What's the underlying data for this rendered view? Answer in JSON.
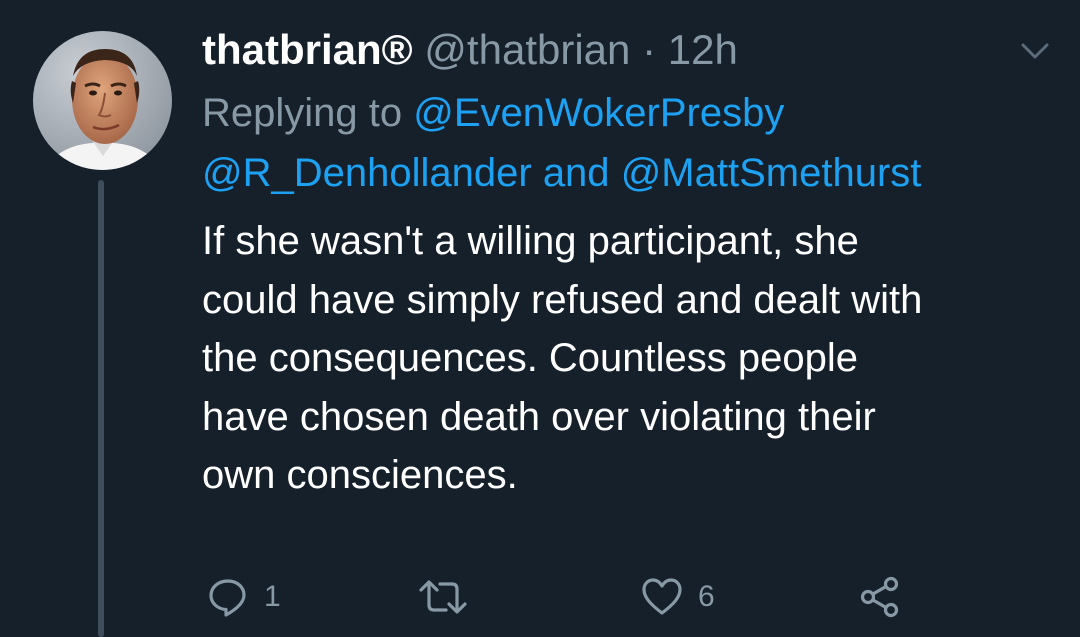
{
  "tweet": {
    "display_name": "thatbrian®",
    "handle": "@thatbrian",
    "separator": "·",
    "time": "12h",
    "replying_to_label": "Replying to",
    "mentions": [
      "@EvenWokerPresby",
      "@R_Denhollander",
      "@MattSmethurst"
    ],
    "mention_joiner": "and",
    "body_lines": [
      "If she wasn't a willing participant, she",
      "could have simply refused and dealt with",
      "the consequences. Countless people",
      "have chosen death over violating their",
      "own consciences."
    ],
    "actions": {
      "reply": {
        "icon": "reply-icon",
        "count": "1"
      },
      "retweet": {
        "icon": "retweet-icon",
        "count": ""
      },
      "like": {
        "icon": "heart-icon",
        "count": "6"
      },
      "share": {
        "icon": "share-icon"
      }
    },
    "menu_icon": "chevron-down-icon"
  },
  "colors": {
    "background": "#16202b",
    "secondary_text": "#8899a6",
    "link": "#1da1f2",
    "primary_text": "#ffffff",
    "thread_line": "#3e4c5c"
  }
}
